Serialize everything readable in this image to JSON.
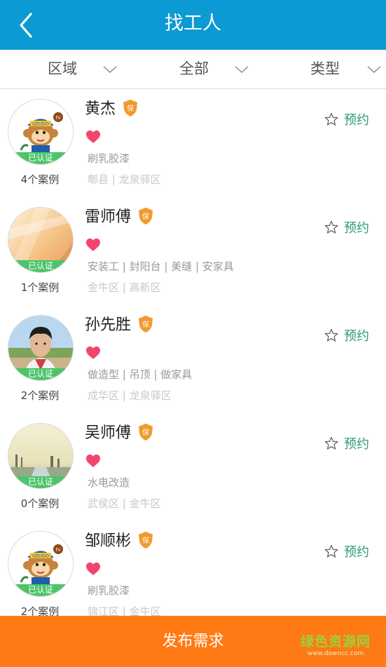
{
  "header": {
    "title": "找工人",
    "back_icon": "chevron-left-icon"
  },
  "filters": [
    {
      "label": "区域",
      "icon": "chevron-down-icon"
    },
    {
      "label": "全部",
      "icon": "chevron-down-icon"
    },
    {
      "label": "类型",
      "icon": "chevron-down-icon"
    }
  ],
  "workers": [
    {
      "name": "黄杰",
      "badge": "保",
      "verified": "已认证",
      "cases": "4个案例",
      "tags": "刷乳胶漆",
      "area": "郫县 | 龙泉驿区",
      "book_label": "预约",
      "avatar": "mascot"
    },
    {
      "name": "雷师傅",
      "badge": "保",
      "verified": "已认证",
      "cases": "1个案例",
      "tags": "安装工 | 封阳台 | 美缝 | 安家具",
      "area": "金牛区 | 高新区",
      "book_label": "预约",
      "avatar": "abstract"
    },
    {
      "name": "孙先胜",
      "badge": "保",
      "verified": "已认证",
      "cases": "2个案例",
      "tags": "做造型 | 吊顶 | 做家具",
      "area": "成华区 | 龙泉驿区",
      "book_label": "预约",
      "avatar": "portrait"
    },
    {
      "name": "吴师傅",
      "badge": "保",
      "verified": "已认证",
      "cases": "0个案例",
      "tags": "水电改造",
      "area": "武侯区 | 金牛区",
      "book_label": "预约",
      "avatar": "landscape"
    },
    {
      "name": "邹顺彬",
      "badge": "保",
      "verified": "已认证",
      "cases": "2个案例",
      "tags": "刷乳胶漆",
      "area": "锦江区 | 金牛区",
      "book_label": "预约",
      "avatar": "mascot"
    }
  ],
  "mascot_text": {
    "brand": "UZUDO",
    "hi": "hi"
  },
  "publish": {
    "label": "发布需求"
  },
  "watermark": {
    "line1": "绿色资源网",
    "line2": "www.downcc.com"
  },
  "colors": {
    "header": "#0b9ad3",
    "publish": "#ff7a14",
    "verified": "#4cc46a",
    "book": "#2e9b6e",
    "heart": "#f0466e",
    "badge": "#f29a2e"
  }
}
